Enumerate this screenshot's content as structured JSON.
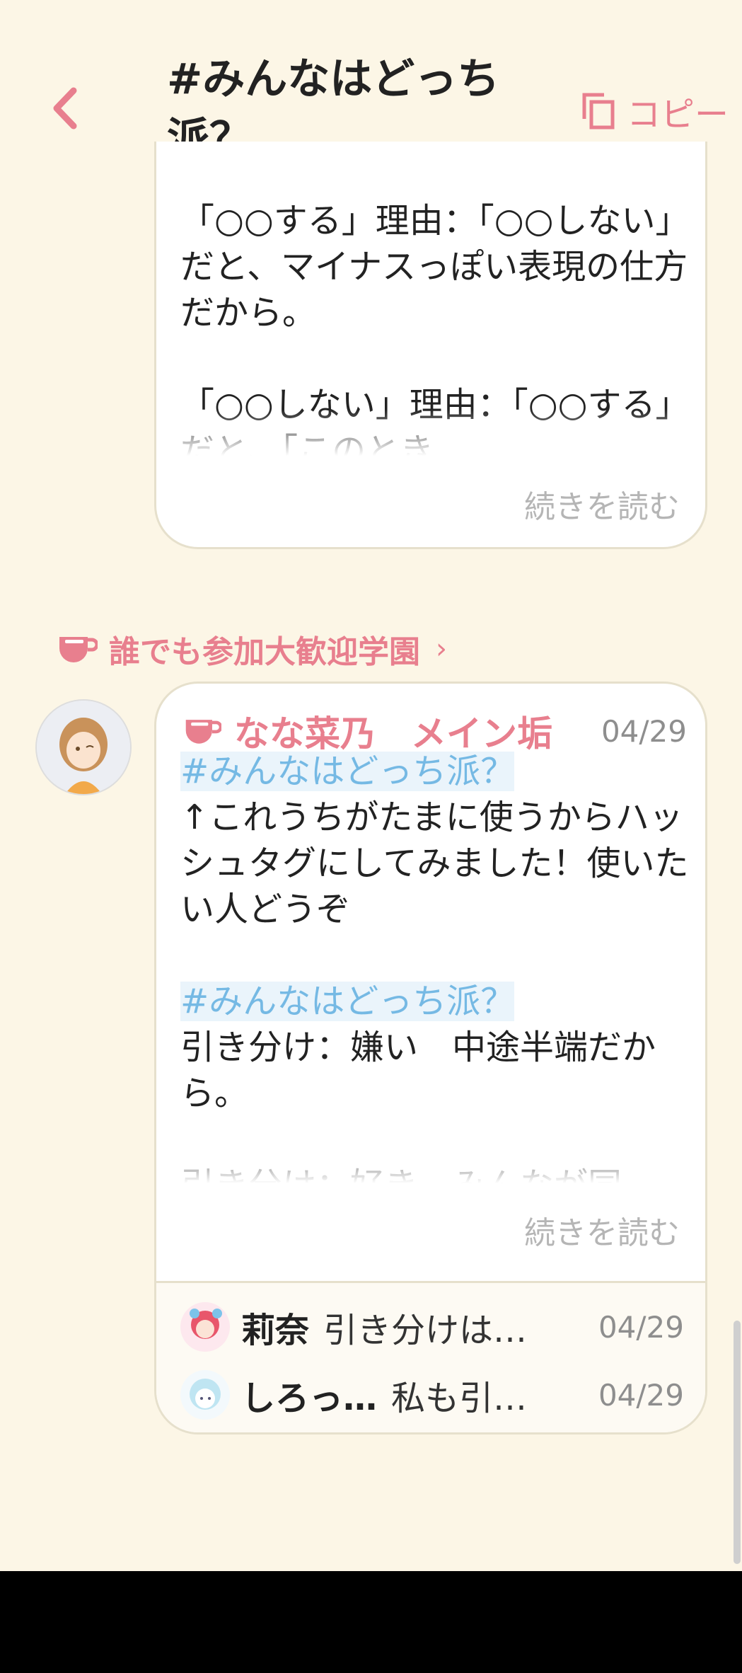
{
  "header": {
    "title": "#みんなはどっち派？",
    "copy_label": "コピー"
  },
  "post1": {
    "text": "「○○する」理由：「○○しない」だと、マイナスっぽい表現の仕方だから。\n\n「○○しない」理由：「○○する」だと、「このとき",
    "read_more": "続きを読む"
  },
  "group": {
    "name": "誰でも参加大歓迎学園"
  },
  "post2": {
    "author": "なな菜乃　メイン垢",
    "date": "04/29",
    "tag1": "#みんなはどっち派？",
    "text1": "↑これうちがたまに使うからハッシュタグにしてみました！使いたい人どうぞ",
    "tag2": "#みんなはどっち派？",
    "text2": "引き分け：嫌い　中途半端だから。\n\n引き分け：好き　みんなが同",
    "read_more": "続きを読む"
  },
  "replies": [
    {
      "name": "莉奈",
      "text": "引き分けは…",
      "date": "04/29"
    },
    {
      "name": "しろっ…",
      "text": "私も引…",
      "date": "04/29"
    }
  ],
  "colors": {
    "background": "#fcf6e6",
    "accent": "#e87f8e",
    "hashtag": "#75b9e4",
    "muted": "#b5b5b5"
  }
}
